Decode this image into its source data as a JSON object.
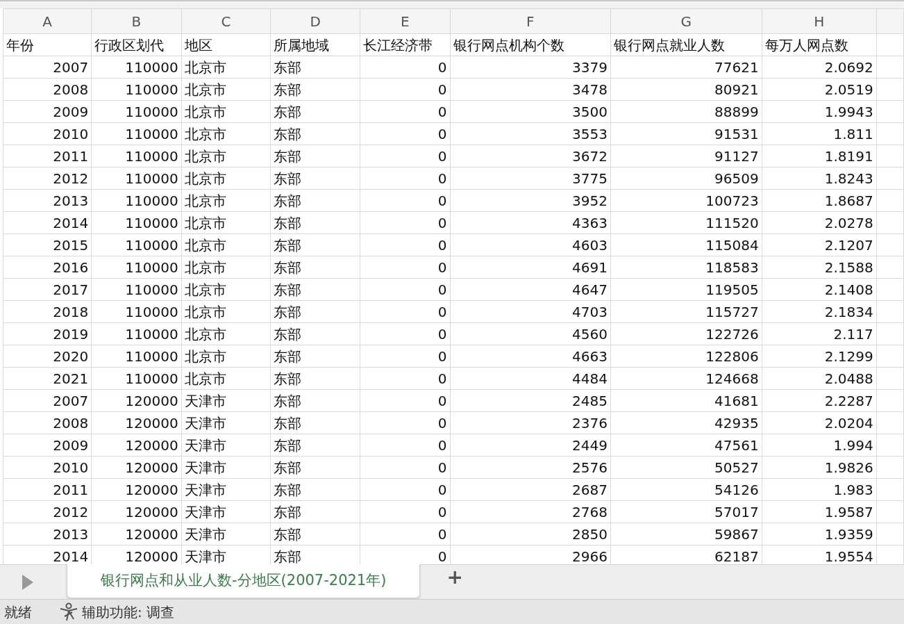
{
  "columns": [
    {
      "letter": "A",
      "kind": "number"
    },
    {
      "letter": "B",
      "kind": "number"
    },
    {
      "letter": "C",
      "kind": "text"
    },
    {
      "letter": "D",
      "kind": "text"
    },
    {
      "letter": "E",
      "kind": "number"
    },
    {
      "letter": "F",
      "kind": "number"
    },
    {
      "letter": "G",
      "kind": "number"
    },
    {
      "letter": "H",
      "kind": "number"
    }
  ],
  "header_row": [
    "年份",
    "行政区划代",
    "地区",
    "所属地域",
    "长江经济带",
    "银行网点机构个数",
    "银行网点就业人数",
    "每万人网点数"
  ],
  "rows": [
    [
      "2007",
      "110000",
      "北京市",
      "东部",
      "0",
      "3379",
      "77621",
      "2.0692"
    ],
    [
      "2008",
      "110000",
      "北京市",
      "东部",
      "0",
      "3478",
      "80921",
      "2.0519"
    ],
    [
      "2009",
      "110000",
      "北京市",
      "东部",
      "0",
      "3500",
      "88899",
      "1.9943"
    ],
    [
      "2010",
      "110000",
      "北京市",
      "东部",
      "0",
      "3553",
      "91531",
      "1.811"
    ],
    [
      "2011",
      "110000",
      "北京市",
      "东部",
      "0",
      "3672",
      "91127",
      "1.8191"
    ],
    [
      "2012",
      "110000",
      "北京市",
      "东部",
      "0",
      "3775",
      "96509",
      "1.8243"
    ],
    [
      "2013",
      "110000",
      "北京市",
      "东部",
      "0",
      "3952",
      "100723",
      "1.8687"
    ],
    [
      "2014",
      "110000",
      "北京市",
      "东部",
      "0",
      "4363",
      "111520",
      "2.0278"
    ],
    [
      "2015",
      "110000",
      "北京市",
      "东部",
      "0",
      "4603",
      "115084",
      "2.1207"
    ],
    [
      "2016",
      "110000",
      "北京市",
      "东部",
      "0",
      "4691",
      "118583",
      "2.1588"
    ],
    [
      "2017",
      "110000",
      "北京市",
      "东部",
      "0",
      "4647",
      "119505",
      "2.1408"
    ],
    [
      "2018",
      "110000",
      "北京市",
      "东部",
      "0",
      "4703",
      "115727",
      "2.1834"
    ],
    [
      "2019",
      "110000",
      "北京市",
      "东部",
      "0",
      "4560",
      "122726",
      "2.117"
    ],
    [
      "2020",
      "110000",
      "北京市",
      "东部",
      "0",
      "4663",
      "122806",
      "2.1299"
    ],
    [
      "2021",
      "110000",
      "北京市",
      "东部",
      "0",
      "4484",
      "124668",
      "2.0488"
    ],
    [
      "2007",
      "120000",
      "天津市",
      "东部",
      "0",
      "2485",
      "41681",
      "2.2287"
    ],
    [
      "2008",
      "120000",
      "天津市",
      "东部",
      "0",
      "2376",
      "42935",
      "2.0204"
    ],
    [
      "2009",
      "120000",
      "天津市",
      "东部",
      "0",
      "2449",
      "47561",
      "1.994"
    ],
    [
      "2010",
      "120000",
      "天津市",
      "东部",
      "0",
      "2576",
      "50527",
      "1.9826"
    ],
    [
      "2011",
      "120000",
      "天津市",
      "东部",
      "0",
      "2687",
      "54126",
      "1.983"
    ],
    [
      "2012",
      "120000",
      "天津市",
      "东部",
      "0",
      "2768",
      "57017",
      "1.9587"
    ],
    [
      "2013",
      "120000",
      "天津市",
      "东部",
      "0",
      "2850",
      "59867",
      "1.9359"
    ],
    [
      "2014",
      "120000",
      "天津市",
      "东部",
      "0",
      "2966",
      "62187",
      "1.9554"
    ]
  ],
  "sheet_tabs": [
    {
      "label": "银行网点和从业人数-分地区(2007-2021年)",
      "selected": true
    }
  ],
  "add_sheet_button": "+",
  "status_bar": {
    "state": "就绪",
    "accessibility": "辅助功能: 调查"
  }
}
